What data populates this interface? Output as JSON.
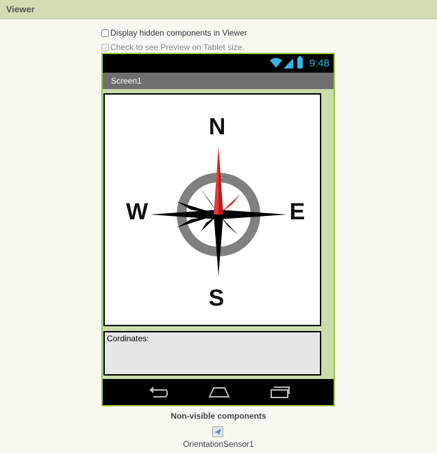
{
  "panel": {
    "title": "Viewer"
  },
  "options": {
    "hidden_components": "Display hidden components in Viewer",
    "tablet_preview": "Check to see Preview on Tablet size."
  },
  "phone": {
    "status_time": "9:48",
    "screen_title": "Screen1",
    "compass": {
      "north": "N",
      "south": "S",
      "east": "E",
      "west": "W"
    },
    "coords_label": "Cordinates:"
  },
  "nonvisible": {
    "title": "Non-visible components",
    "sensor_label": "OrientationSensor1"
  },
  "colors": {
    "header_bg": "#d1deb3",
    "phone_border": "#9bc53d",
    "status_accent": "#33b5e5",
    "needle_red": "#d32f2f"
  }
}
